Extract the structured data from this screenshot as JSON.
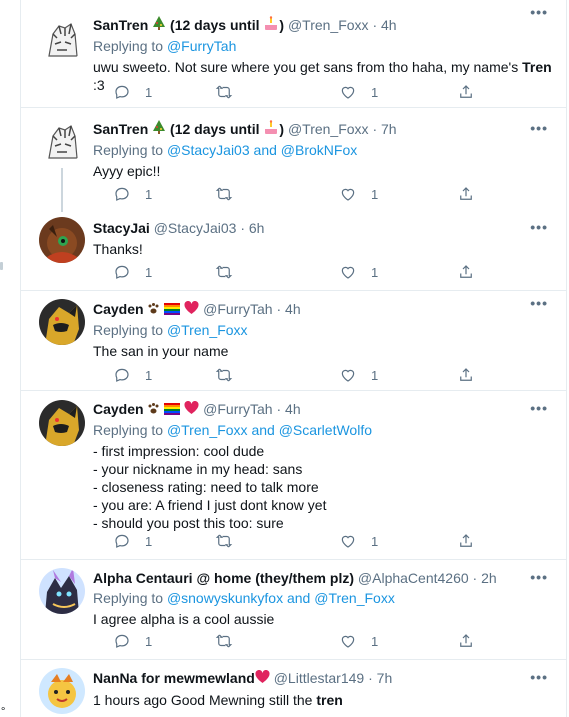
{
  "tweets": [
    {
      "name": "SanTren",
      "name_suffix": "(12 days until",
      "handle": "@Tren_Foxx",
      "time": "4h",
      "replying_prefix": "Replying to",
      "replying_to": "@FurryTah",
      "replying_joiner": "",
      "replying_to_2": "",
      "text_before": "uwu sweeto. Not sure where you get sans from tho haha, my name's ",
      "text_bold": "Tren",
      "text_after": " :3",
      "replies": "1",
      "likes": "1"
    },
    {
      "name": "SanTren",
      "name_suffix": "(12 days until",
      "handle": "@Tren_Foxx",
      "time": "7h",
      "replying_prefix": "Replying to",
      "replying_to": "@StacyJai03",
      "replying_joiner": "and",
      "replying_to_2": "@BrokNFox",
      "text": "Ayyy epic!!",
      "replies": "1",
      "likes": "1"
    },
    {
      "name": "StacyJai",
      "handle": "@StacyJai03",
      "time": "6h",
      "text": "Thanks!",
      "replies": "1",
      "likes": "1"
    },
    {
      "name": "Cayden",
      "handle": "@FurryTah",
      "time": "4h",
      "replying_prefix": "Replying to",
      "replying_to": "@Tren_Foxx",
      "text": "The san in your name",
      "replies": "1",
      "likes": "1"
    },
    {
      "name": "Cayden",
      "handle": "@FurryTah",
      "time": "4h",
      "replying_prefix": "Replying to",
      "replying_to": "@Tren_Foxx",
      "replying_joiner": "and",
      "replying_to_2": "@ScarletWolfo",
      "text": "- first impression: cool dude\n- your nickname in my head: sans\n- closeness rating: need to talk more\n- you are: A friend I just dont know yet\n- should you post this too: sure",
      "replies": "1",
      "likes": "1"
    },
    {
      "name": "Alpha Centauri @ home (they/them plz)",
      "handle": "@AlphaCent4260",
      "time": "2h",
      "replying_prefix": "Replying to",
      "replying_to": "@snowyskunkyfox",
      "replying_joiner": "and",
      "replying_to_2": "@Tren_Foxx",
      "text": "I agree alpha is a cool aussie",
      "replies": "1",
      "likes": "1"
    },
    {
      "name": "NanNa for mewmewland",
      "handle": "@Littlestar149",
      "time": "7h",
      "text_before": "1 hours ago  Good Mewning still the ",
      "text_bold": "tren"
    }
  ],
  "sep": "·",
  "more_icon": "more-dots",
  "colors": {
    "link": "#1b95e0",
    "muted": "#5b7083",
    "border": "#e6ecf0"
  }
}
